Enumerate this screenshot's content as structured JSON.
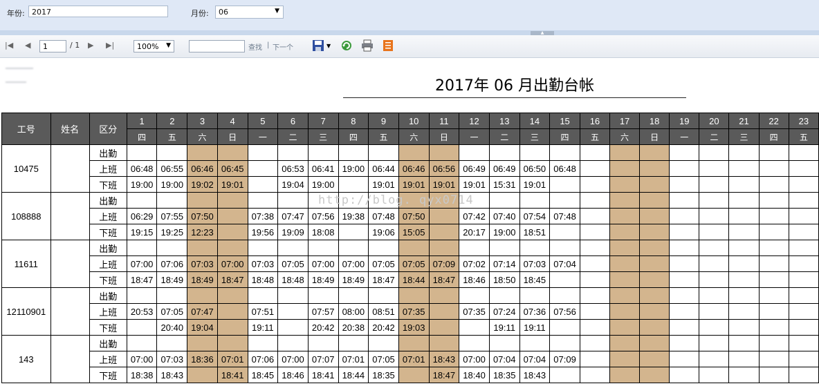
{
  "params": {
    "year_label": "年份:",
    "year_value": "2017",
    "month_label": "月份:",
    "month_value": "06"
  },
  "toolbar": {
    "page_value": "1",
    "page_total": "/ 1",
    "zoom_value": "100%",
    "find_label": "查找",
    "find_separator": "|",
    "next_label": "下一个"
  },
  "report": {
    "title": "2017年  06 月出勤台帐",
    "watermark": "http://blog.        qyx0714"
  },
  "table": {
    "headers": {
      "id": "工号",
      "name": "姓名",
      "type": "区分"
    },
    "days": [
      "1",
      "2",
      "3",
      "4",
      "5",
      "6",
      "7",
      "8",
      "9",
      "10",
      "11",
      "12",
      "13",
      "14",
      "15",
      "16",
      "17",
      "18",
      "19",
      "20",
      "21",
      "22",
      "23"
    ],
    "weekdays": [
      "四",
      "五",
      "六",
      "日",
      "一",
      "二",
      "三",
      "四",
      "五",
      "六",
      "日",
      "一",
      "二",
      "三",
      "四",
      "五",
      "六",
      "日",
      "一",
      "二",
      "三",
      "四",
      "五"
    ],
    "row_types": [
      "出勤",
      "上班",
      "下班"
    ],
    "employees": [
      {
        "id": "10475",
        "name": "",
        "in": [
          "06:48",
          "06:55",
          "06:46",
          "06:45",
          "",
          "06:53",
          "06:41",
          "19:00",
          "06:44",
          "06:46",
          "06:56",
          "06:49",
          "06:49",
          "06:50",
          "06:48",
          "",
          "",
          "",
          "",
          "",
          "",
          "",
          ""
        ],
        "out": [
          "19:00",
          "19:00",
          "19:02",
          "19:01",
          "",
          "19:04",
          "19:00",
          "",
          "19:01",
          "19:01",
          "19:01",
          "19:01",
          "15:31",
          "19:01",
          "",
          "",
          "",
          "",
          "",
          "",
          "",
          "",
          ""
        ]
      },
      {
        "id": "108888",
        "name": "",
        "in": [
          "06:29",
          "07:55",
          "07:50",
          "",
          "07:38",
          "07:47",
          "07:56",
          "19:38",
          "07:48",
          "07:50",
          "",
          "07:42",
          "07:40",
          "07:54",
          "07:48",
          "",
          "",
          "",
          "",
          "",
          "",
          "",
          ""
        ],
        "out": [
          "19:15",
          "19:25",
          "12:23",
          "",
          "19:56",
          "19:09",
          "18:08",
          "",
          "19:06",
          "15:05",
          "",
          "20:17",
          "19:00",
          "18:51",
          "",
          "",
          "",
          "",
          "",
          "",
          "",
          "",
          ""
        ]
      },
      {
        "id": "11611",
        "name": "",
        "in": [
          "07:00",
          "07:06",
          "07:03",
          "07:00",
          "07:03",
          "07:05",
          "07:00",
          "07:00",
          "07:05",
          "07:05",
          "07:09",
          "07:02",
          "07:14",
          "07:03",
          "07:04",
          "",
          "",
          "",
          "",
          "",
          "",
          "",
          ""
        ],
        "out": [
          "18:47",
          "18:49",
          "18:49",
          "18:47",
          "18:48",
          "18:48",
          "18:49",
          "18:49",
          "18:47",
          "18:44",
          "18:47",
          "18:46",
          "18:50",
          "18:45",
          "",
          "",
          "",
          "",
          "",
          "",
          "",
          "",
          ""
        ]
      },
      {
        "id": "12110901",
        "name": "",
        "in": [
          "20:53",
          "07:05",
          "07:47",
          "",
          "07:51",
          "",
          "07:57",
          "08:00",
          "08:51",
          "07:35",
          "",
          "07:35",
          "07:24",
          "07:36",
          "07:56",
          "",
          "",
          "",
          "",
          "",
          "",
          "",
          ""
        ],
        "out": [
          "",
          "20:40",
          "19:04",
          "",
          "19:11",
          "",
          "20:42",
          "20:38",
          "20:42",
          "19:03",
          "",
          "",
          "19:11",
          "19:11",
          "",
          "",
          "",
          "",
          "",
          "",
          "",
          "",
          ""
        ]
      },
      {
        "id": "143",
        "name": "",
        "in": [
          "07:00",
          "07:03",
          "18:36",
          "07:01",
          "07:06",
          "07:00",
          "07:07",
          "07:01",
          "07:05",
          "07:01",
          "18:43",
          "07:00",
          "07:04",
          "07:04",
          "07:09",
          "",
          "",
          "",
          "",
          "",
          "",
          "",
          ""
        ],
        "out": [
          "18:38",
          "18:43",
          "",
          "18:41",
          "18:45",
          "18:46",
          "18:41",
          "18:44",
          "18:35",
          "",
          "18:47",
          "18:40",
          "18:35",
          "18:43",
          "",
          "",
          "",
          "",
          "",
          "",
          "",
          "",
          ""
        ]
      }
    ]
  },
  "colors": {
    "header_bg": "#5a5a5a",
    "weekend_bg": "#d3b58e",
    "param_bar_bg": "#dfe8f6"
  }
}
